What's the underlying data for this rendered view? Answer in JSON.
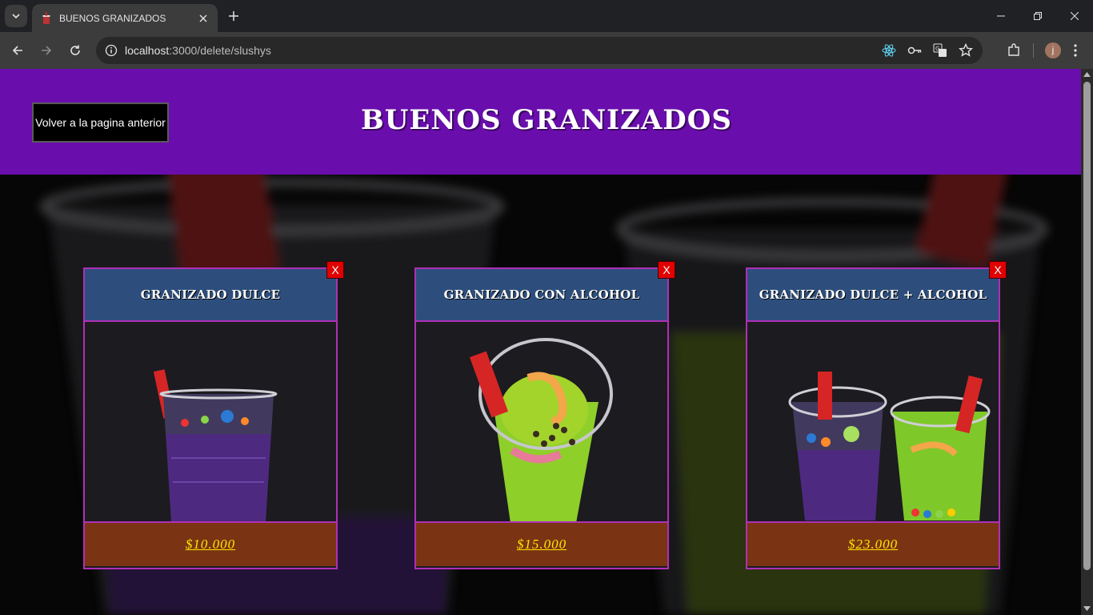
{
  "browser": {
    "tab_title": "BUENOS GRANIZADOS",
    "url_host": "localhost",
    "url_rest": ":3000/delete/slushys",
    "avatar_letter": "j"
  },
  "header": {
    "back_label": "Volver a la pagina anterior",
    "title": "BUENOS GRANIZADOS"
  },
  "products": [
    {
      "name": "GRANIZADO DULCE",
      "price": "$10.000",
      "delete_label": "X"
    },
    {
      "name": "GRANIZADO CON ALCOHOL",
      "price": "$15.000",
      "delete_label": "X"
    },
    {
      "name": "GRANIZADO DULCE + ALCOHOL",
      "price": "$23.000",
      "delete_label": "X"
    }
  ],
  "colors": {
    "header_bg": "#6a0dad",
    "card_border": "#b02fb6",
    "card_head_bg": "#2d4e7c",
    "price_bg": "#7a3413",
    "price_text": "#ffe600",
    "delete_bg": "#e00000"
  }
}
